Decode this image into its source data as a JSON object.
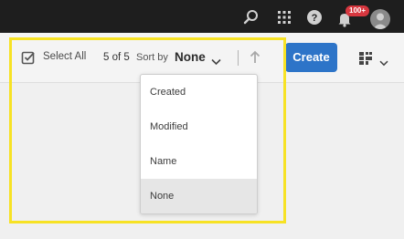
{
  "notifications": {
    "count_badge": "100+"
  },
  "actionbar": {
    "select_all_label": "Select All",
    "count_text": "5 of 5",
    "sort_by_label": "Sort by",
    "sort_value": "None",
    "create_label": "Create"
  },
  "sort_menu": {
    "options": [
      {
        "label": "Created"
      },
      {
        "label": "Modified"
      },
      {
        "label": "Name"
      },
      {
        "label": "None"
      }
    ],
    "selected": "None"
  },
  "colors": {
    "topbar": "#1e1e1e",
    "accent": "#2d74c8",
    "badge": "#d7373f",
    "highlight": "#f7e224"
  },
  "icons": [
    "search-icon",
    "apps-grid-icon",
    "help-icon",
    "bell-icon",
    "checkbox-icon",
    "chevron-down-icon",
    "sort-ascending-icon",
    "view-switcher-icon"
  ]
}
